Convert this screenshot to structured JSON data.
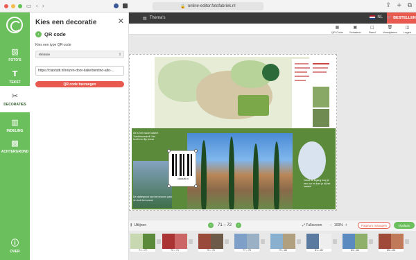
{
  "browser": {
    "url": "online-editor.fotofabriek.nl"
  },
  "app_bar": {
    "themes_label": "Thema's",
    "lang": "NL",
    "order_label": "BESTELLEN"
  },
  "toolbar": {
    "tools": [
      {
        "icon": "qr-code-icon",
        "label": "QR Code"
      },
      {
        "icon": "shadow-icon",
        "label": "Schaduw"
      },
      {
        "icon": "border-icon",
        "label": "Rand"
      },
      {
        "icon": "delete-icon",
        "label": "Verwijderen"
      },
      {
        "icon": "layers-icon",
        "label": "Lagen"
      }
    ]
  },
  "sidebar": {
    "items": [
      {
        "label": "FOTO'S",
        "icon": "image-icon"
      },
      {
        "label": "TEKST",
        "icon": "text-icon"
      },
      {
        "label": "DECORATIES",
        "icon": "decorations-icon",
        "active": true
      },
      {
        "label": "INDELING",
        "icon": "layout-icon"
      },
      {
        "label": "ACHTERGROND",
        "icon": "background-icon"
      },
      {
        "label": "OVER",
        "icon": "info-icon"
      }
    ]
  },
  "panel": {
    "title": "Kies een decoratie",
    "section": "QR code",
    "type_label": "Kies een type QR-code",
    "type_value": "Website",
    "url_value": "https://ciaotutti.nl/reizen-door-italie/trentino-alto-...",
    "add_button": "QR code toevoegen"
  },
  "canvas": {
    "qr_caption": "ciaotutti.nl",
    "left_text": "De plattegrond van het enorme park. Je vindt het overal",
    "mid_text": "Dit is het mooie kasteel Trauttmansdorff. Het heeft een fijn terras",
    "right_text": "Vanaf de ingang loop je een uur en kom je bij het kasteel"
  },
  "bottom": {
    "align_label": "Uitlijnen",
    "pages": "71 – 72",
    "fullscreen_label": "Fullscreen",
    "zoom": "100%",
    "manage_pages": "Pagina's managen",
    "save": "Opslaan"
  },
  "thumbnails": [
    {
      "label": "71 – 72"
    },
    {
      "label": "73 – 74"
    },
    {
      "label": "75 – 76"
    },
    {
      "label": "77 – 78"
    },
    {
      "label": "79 – 80"
    },
    {
      "label": "81 – 82"
    },
    {
      "label": "83 – 84"
    },
    {
      "label": "85 – 86"
    }
  ],
  "colors": {
    "brand_green": "#6cbf5d",
    "accent_red": "#e85a4f",
    "topbar": "#3a3a3a"
  }
}
